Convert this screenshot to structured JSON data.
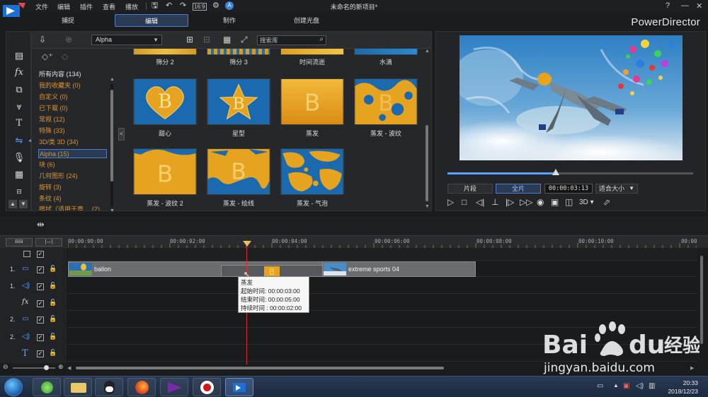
{
  "app": {
    "window_title": "未命名的新项目*",
    "brand": "PowerDirector",
    "menu": [
      "文件",
      "编辑",
      "插件",
      "查看",
      "播放"
    ],
    "modes": [
      "捕捉",
      "编辑",
      "制作",
      "创建光盘"
    ],
    "active_mode": "编辑"
  },
  "library": {
    "filter_select": "Alpha",
    "search_placeholder": "搜索库",
    "categories": [
      {
        "label": "所有内容 (134)",
        "color": "white"
      },
      {
        "label": "我的收藏夹  (0)",
        "color": "orange"
      },
      {
        "label": "自定义  (0)",
        "color": "orange"
      },
      {
        "label": "已下载  (0)",
        "color": "orange"
      },
      {
        "label": "常规  (12)",
        "color": "orange"
      },
      {
        "label": "特殊  (33)",
        "color": "orange"
      },
      {
        "label": "3D/类 3D  (34)",
        "color": "orange"
      },
      {
        "label": "Alpha  (15)",
        "color": "orange",
        "active": true
      },
      {
        "label": "块  (6)",
        "color": "orange"
      },
      {
        "label": "几何图形  (24)",
        "color": "orange"
      },
      {
        "label": "旋转  (3)",
        "color": "orange"
      },
      {
        "label": "条纹  (4)",
        "color": "orange"
      },
      {
        "label": "擦拭（适用于章",
        "color": "orange"
      }
    ],
    "category_partial_count": "(2)",
    "transitions_row0": [
      "筛分 2",
      "筛分 3",
      "时间流逝",
      "水滴"
    ],
    "transitions_row1": [
      "甜心",
      "星型",
      "蒸发",
      "蒸发 - 波纹"
    ],
    "transitions_row2": [
      "蒸发 - 波纹 2",
      "蒸发 - 绘线",
      "蒸发 - 气泡"
    ]
  },
  "preview": {
    "clip_btn": "片段",
    "full_btn": "全片",
    "timecode": "00:00:03:13",
    "fit": "适合大小",
    "mode_3d": "3D",
    "seek_fraction": 0.44
  },
  "timeline": {
    "ruler": [
      "00:00:00:00",
      "00:00:02:00",
      "00:00:04:00",
      "00:00:06:00",
      "00:00:08:00",
      "00:00:10:00",
      "00:00"
    ],
    "track_labels": [
      "1.",
      "1.",
      "",
      "2.",
      "2.",
      ""
    ],
    "clips": {
      "clip1": "ballon",
      "clip2": "extreme sports 04"
    },
    "tooltip": {
      "title": "蒸发",
      "start": "起始时间: 00:00:03:00",
      "end": "结束时间: 00:00:05:00",
      "duration": "持续时间 :  00:00:02:00"
    }
  },
  "taskbar": {
    "time": "20:33",
    "date": "2018/12/23"
  },
  "watermark": {
    "brand": "Bai",
    "brand2": "du",
    "cn": "经验",
    "url": "jingyan.baidu.com"
  },
  "colors": {
    "accent": "#4d7fc8",
    "category_text": "#d69533",
    "gold": "#e3a325",
    "blue": "#1f7fc0"
  }
}
